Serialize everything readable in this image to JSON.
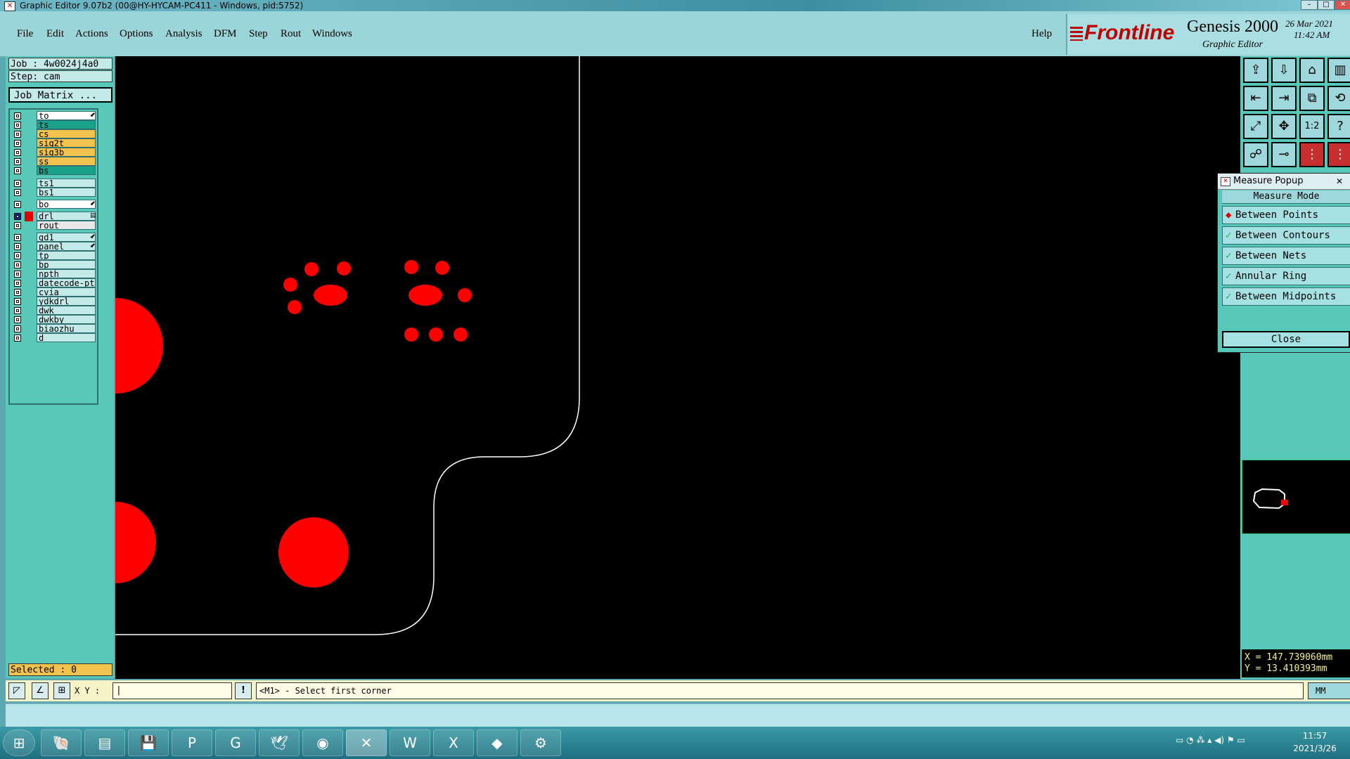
{
  "window": {
    "title": "Graphic Editor 9.07b2 (00@HY-HYCAM-PC411 - Windows, pid:5752)",
    "buttons": [
      "–",
      "□",
      "✕"
    ]
  },
  "menu": {
    "items": [
      "File",
      "Edit",
      "Actions",
      "Options",
      "Analysis",
      "DFM",
      "Step",
      "Rout",
      "Windows"
    ],
    "help": "Help"
  },
  "brand": {
    "logo": "Frontline",
    "product": "Genesis 2000",
    "subtitle": "Graphic Editor",
    "date": "26 Mar 2021",
    "time": "11:42 AM"
  },
  "job": {
    "job_label": "Job : 4w0024j4a0",
    "step_label": "Step: cam",
    "matrix_button": "Job Matrix ..."
  },
  "layers": [
    {
      "name": "to",
      "bg": "#ffffff",
      "color": "",
      "suffix": "⬋"
    },
    {
      "name": "ts",
      "bg": "#1aa38a",
      "color": ""
    },
    {
      "name": "cs",
      "bg": "#f3c34e",
      "color": ""
    },
    {
      "name": "sig2t",
      "bg": "#f3c34e",
      "color": ""
    },
    {
      "name": "sig3b",
      "bg": "#f3c34e",
      "color": ""
    },
    {
      "name": "ss",
      "bg": "#f3c34e",
      "color": ""
    },
    {
      "name": "bs",
      "bg": "#1aa38a",
      "color": ""
    },
    {
      "name": "ts1",
      "bg": "#c5eaea",
      "color": ""
    },
    {
      "name": "bs1",
      "bg": "#c5eaea",
      "color": ""
    },
    {
      "name": "bo",
      "bg": "#ffffff",
      "color": "",
      "suffix": "⬋"
    },
    {
      "name": "drl",
      "bg": "#c5eaea",
      "color": "#e00000",
      "suffix": "▤",
      "selected": true
    },
    {
      "name": "rout",
      "bg": "#e8e8e8",
      "color": ""
    },
    {
      "name": "gd1",
      "bg": "#c5eaea",
      "color": "",
      "suffix": "⬋"
    },
    {
      "name": "panel",
      "bg": "#c5eaea",
      "color": "",
      "suffix": "⬋"
    },
    {
      "name": "tp",
      "bg": "#c5eaea",
      "color": ""
    },
    {
      "name": "bp",
      "bg": "#c5eaea",
      "color": ""
    },
    {
      "name": "npth",
      "bg": "#c5eaea",
      "color": ""
    },
    {
      "name": "datecode-pt",
      "bg": "#c5eaea",
      "color": ""
    },
    {
      "name": "cvia",
      "bg": "#c5eaea",
      "color": ""
    },
    {
      "name": "ydkdrl",
      "bg": "#c5eaea",
      "color": ""
    },
    {
      "name": "dwk",
      "bg": "#c5eaea",
      "color": ""
    },
    {
      "name": "dwkby",
      "bg": "#c5eaea",
      "color": ""
    },
    {
      "name": "biaozhu",
      "bg": "#c5eaea",
      "color": ""
    },
    {
      "name": "d",
      "bg": "#c5eaea",
      "color": ""
    }
  ],
  "selected": "Selected : 0",
  "toolbar_icons": [
    "layer-up-icon",
    "layer-down-icon",
    "home-icon",
    "split-view-icon",
    "pan-left-icon",
    "pan-right-icon",
    "mirror-icon",
    "snap-icon",
    "zoom-fit-icon",
    "zoom-center-icon",
    "scale-icon",
    "help-query-icon",
    "route-icon",
    "measure-icon",
    "net-red-icon",
    "net-red-2-icon"
  ],
  "toolbar_glyphs": [
    "⇪",
    "⇩",
    "⌂",
    "▥",
    "⇤",
    "⇥",
    "⧉",
    "⟲",
    "⤢",
    "✥",
    "1:2",
    "?",
    "☍",
    "⊸",
    "⋮",
    "⋮"
  ],
  "measure_popup": {
    "title": "Measure Popup",
    "heading": "Measure Mode",
    "options": [
      "Between Points",
      "Between Contours",
      "Between Nets",
      "Annular Ring",
      "Between Midpoints"
    ],
    "selected_index": 0,
    "close": "Close"
  },
  "coords": {
    "x": "X = 147.739060mm",
    "y": "Y = 13.410393mm"
  },
  "status": {
    "xy_label": "X Y :",
    "xy_value": "|",
    "excl": "!",
    "prompt": "<M1> - Select first corner",
    "unit": "MM"
  },
  "taskbar": {
    "apps": [
      "start-orb-icon",
      "shell-icon",
      "notepad-icon",
      "save-disk-icon",
      "p-app-icon",
      "g-app-icon",
      "bird-app-icon",
      "eye-app-icon",
      "x-app-icon",
      "word-icon",
      "excel-icon",
      "eraser-icon",
      "network-app-icon"
    ],
    "glyphs": [
      "⊞",
      "🐚",
      "▤",
      "💾",
      "P",
      "G",
      "🕊",
      "◉",
      "✕",
      "W",
      "X",
      "◆",
      "⚙"
    ],
    "time": "11:57",
    "date": "2021/3/26"
  },
  "colors": {
    "pad": "#ff0000",
    "outline": "#ffffff",
    "canvas": "#000000"
  }
}
